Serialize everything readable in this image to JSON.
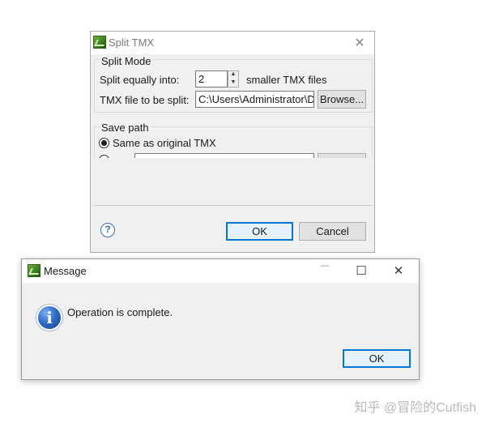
{
  "split_dialog": {
    "title": "Split TMX",
    "close_glyph": "✕",
    "split_mode": {
      "group_label": "Split Mode",
      "equally_label": "Split equally into:",
      "count_value": "2",
      "files_suffix": "smaller TMX files",
      "file_label": "TMX file to be split:",
      "file_value": "C:\\Users\\Administrator\\Desktop",
      "browse_label": "Browse..."
    },
    "save_path": {
      "group_label": "Save path",
      "same_as_original_label": "Same as original TMX"
    },
    "help_glyph": "?",
    "ok_label": "OK",
    "cancel_label": "Cancel"
  },
  "message_dialog": {
    "title": "Message",
    "minimize_glyph": "—",
    "maximize_glyph": "☐",
    "close_glyph": "✕",
    "info_glyph": "i",
    "text": "Operation is complete.",
    "ok_label": "OK"
  },
  "watermark": "知乎 @冒险的Cutfish",
  "colors": {
    "dialog_bg": "#f0f0f0",
    "titlebar_bg": "#ffffff",
    "focus_border": "#0078d7"
  }
}
